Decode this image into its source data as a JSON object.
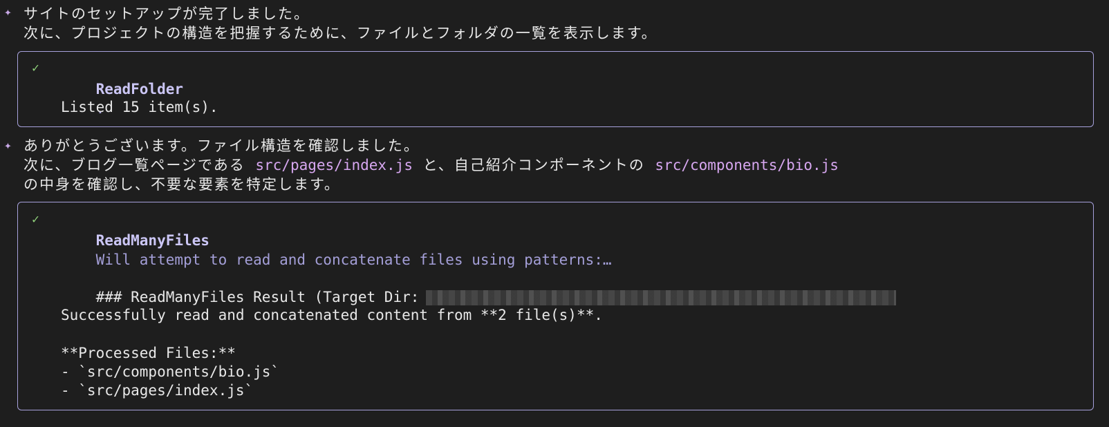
{
  "messages": [
    {
      "lines": [
        "サイトのセットアップが完了しました。",
        "次に、プロジェクトの構造を把握するために、ファイルとフォルダの一覧を表示します。"
      ]
    },
    {
      "line1": "ありがとうございます。ファイル構造を確認しました。",
      "line2_pre": "次に、ブログ一覧ページである ",
      "line2_code1": "src/pages/index.js",
      "line2_mid": " と、自己紹介コンポーネントの ",
      "line2_code2": "src/components/bio.js",
      "line3": "の中身を確認し、不要な要素を特定します。"
    }
  ],
  "tool_calls": [
    {
      "status_icon": "check-icon",
      "name": "ReadFolder",
      "description": ".",
      "output": [
        "Listed 15 item(s)."
      ]
    },
    {
      "status_icon": "check-icon",
      "name": "ReadManyFiles",
      "description": "Will attempt to read and concatenate files using patterns:…",
      "result_heading": "### ReadManyFiles Result (Target Dir:",
      "result_summary": "Successfully read and concatenated content from **2 file(s)**.",
      "processed_heading": "**Processed Files:**",
      "files": [
        "- `src/components/bio.js`",
        "- `src/pages/index.js`"
      ]
    }
  ],
  "colors": {
    "background": "#1e1e1e",
    "text": "#e8e8e8",
    "accent_code": "#d7a7f0",
    "panel_border": "#a7a1dc",
    "check": "#8fcf7a",
    "tool_desc": "#a49fd8"
  }
}
